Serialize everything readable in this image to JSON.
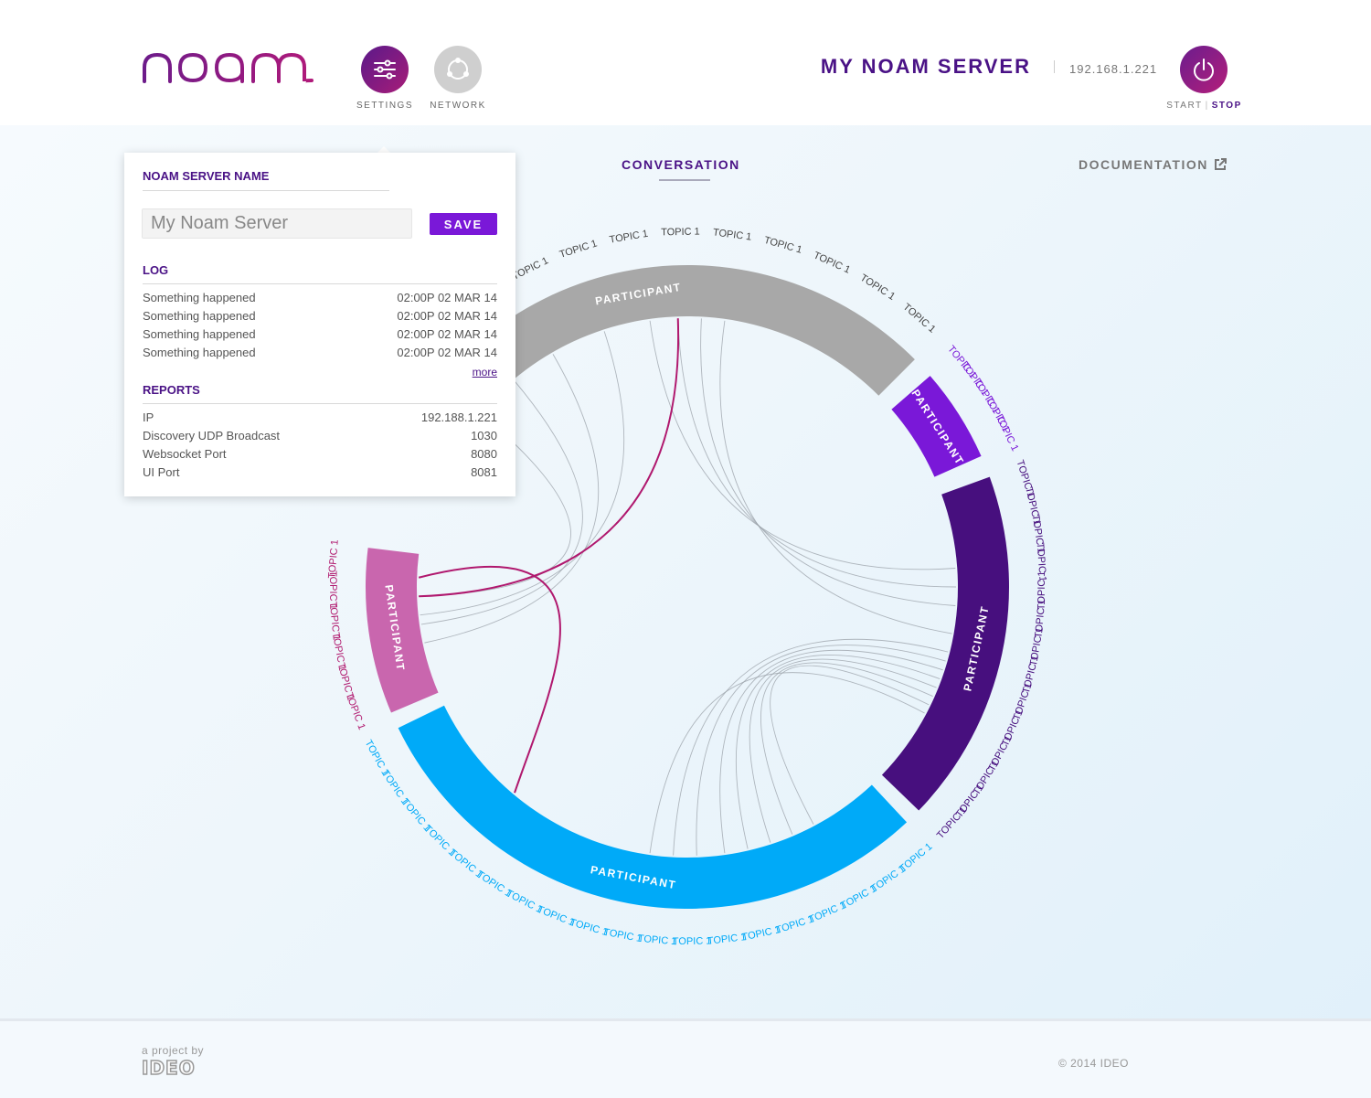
{
  "app": {
    "logo_text": "noam"
  },
  "nav": {
    "settings_label": "SETTINGS",
    "network_label": "NETWORK"
  },
  "header": {
    "server_title": "MY NOAM SERVER",
    "server_ip": "192.168.1.221",
    "start_label": "START",
    "stop_label": "STOP"
  },
  "tabs": {
    "conversation": "CONVERSATION",
    "documentation": "DOCUMENTATION"
  },
  "settings_panel": {
    "name_title": "NOAM SERVER NAME",
    "name_placeholder": "My Noam Server",
    "save_label": "SAVE",
    "log_title": "LOG",
    "log": [
      {
        "message": "Something happened",
        "time": "02:00P 02 MAR 14"
      },
      {
        "message": "Something happened",
        "time": "02:00P 02 MAR 14"
      },
      {
        "message": "Something happened",
        "time": "02:00P 02 MAR 14"
      },
      {
        "message": "Something happened",
        "time": "02:00P 02 MAR 14"
      }
    ],
    "more_label": "more",
    "reports_title": "REPORTS",
    "reports": [
      {
        "label": "IP",
        "value": "192.188.1.221"
      },
      {
        "label": "Discovery UDP Broadcast",
        "value": "1030"
      },
      {
        "label": "Websocket Port",
        "value": "8080"
      },
      {
        "label": "UI Port",
        "value": "8081"
      }
    ]
  },
  "chord": {
    "groups": [
      {
        "label": "PARTICIPANT",
        "color": "#a8a8a8",
        "label_color": "#444444",
        "topics": 13,
        "topic_label": "TOPIC 1"
      },
      {
        "label": "PARTICIPANT",
        "color": "#7a18d8",
        "label_color": "#7a18d8",
        "topics": 5,
        "topic_label": "TOPIC 1"
      },
      {
        "label": "PARTICIPANT",
        "color": "#470f7e",
        "label_color": "#470f7e",
        "topics": 14,
        "topic_label": "TOPIC 1"
      },
      {
        "label": "PARTICIPANT",
        "color": "#00aaf8",
        "label_color": "#00aaf8",
        "topics": 19,
        "topic_label": "TOPIC 1"
      },
      {
        "label": "PARTICIPANT",
        "color": "#c966ae",
        "label_color": "#b0186e",
        "topics": 6,
        "topic_label": "TOPIC 1"
      }
    ],
    "highlight_color": "#b0186e",
    "ribbon_color": "#9aa0a8"
  },
  "footer": {
    "project_by": "a project by",
    "company": "IDEO",
    "copyright": "© 2014 IDEO"
  }
}
